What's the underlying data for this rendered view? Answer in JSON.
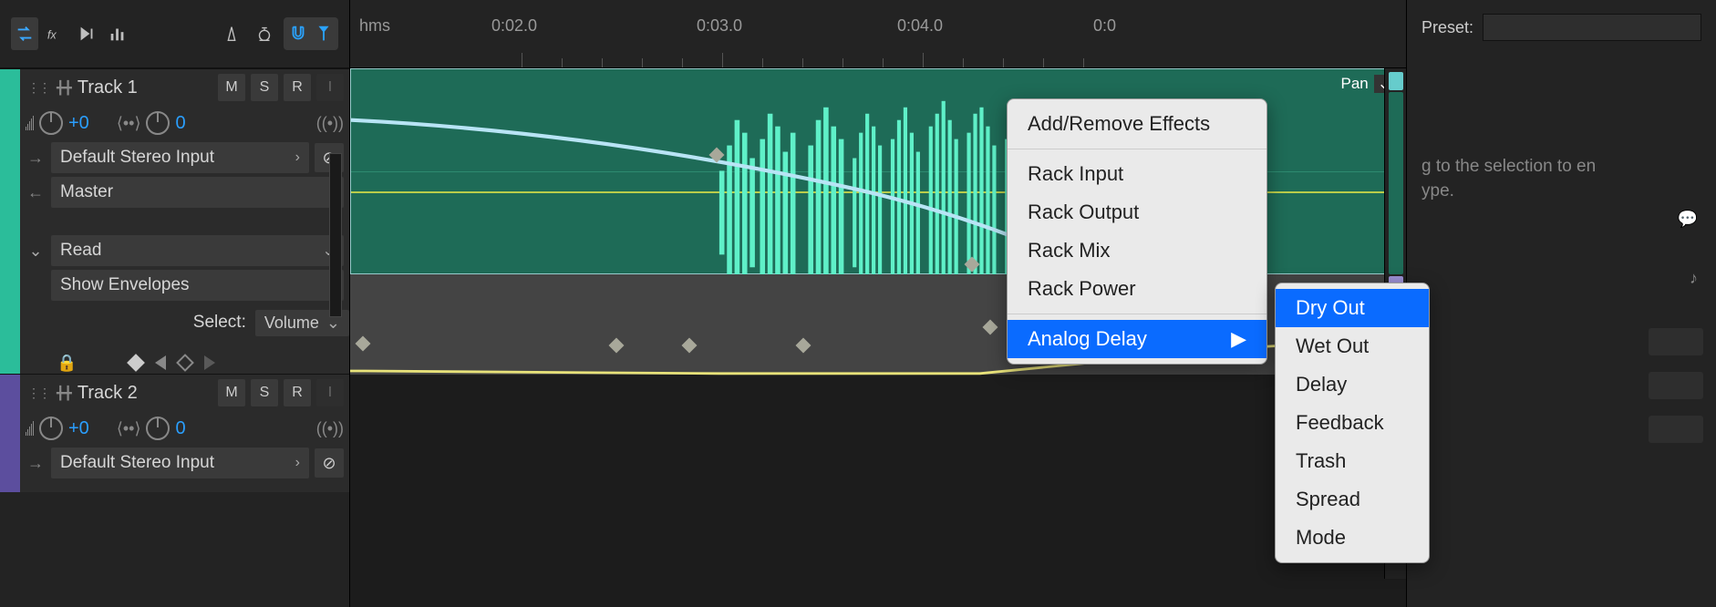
{
  "ruler": {
    "hms": "hms",
    "t1": "0:02.0",
    "t2": "0:03.0",
    "t3": "0:04.0",
    "t4": "0:0"
  },
  "track1": {
    "name": "Track 1",
    "m": "M",
    "s": "S",
    "r": "R",
    "i": "I",
    "vol": "+0",
    "pan": "0",
    "input": "Default Stereo Input",
    "output": "Master",
    "automation": "Read",
    "envelopes": "Show Envelopes",
    "select_label": "Select:",
    "select_value": "Volume",
    "clip_label": "Pan"
  },
  "track2": {
    "name": "Track 2",
    "m": "M",
    "s": "S",
    "r": "R",
    "i": "I",
    "vol": "+0",
    "pan": "0",
    "input": "Default Stereo Input"
  },
  "right": {
    "preset_label": "Preset:",
    "hint_a": "g to the selection to en",
    "hint_b": "ype."
  },
  "menu": {
    "add_remove": "Add/Remove Effects",
    "rack_input": "Rack Input",
    "rack_output": "Rack Output",
    "rack_mix": "Rack Mix",
    "rack_power": "Rack Power",
    "analog_delay": "Analog Delay"
  },
  "submenu": {
    "dry": "Dry Out",
    "wet": "Wet Out",
    "delay": "Delay",
    "feedback": "Feedback",
    "trash": "Trash",
    "spread": "Spread",
    "mode": "Mode"
  }
}
